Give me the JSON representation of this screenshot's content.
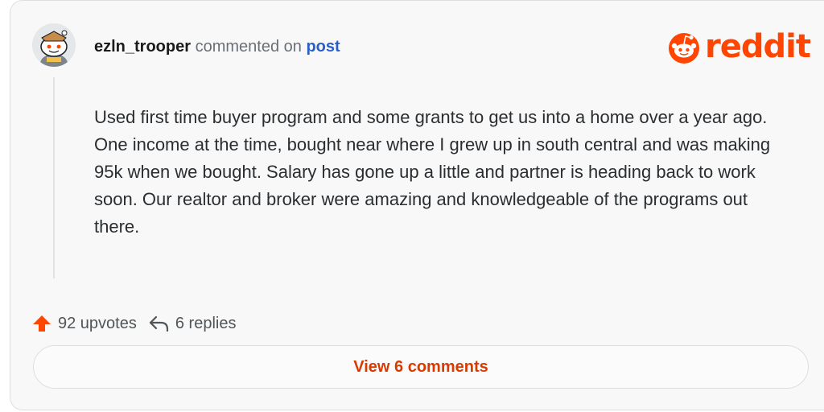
{
  "comment": {
    "author": "ezln_trooper",
    "action_text": "commented on",
    "target_link": "post",
    "body": "Used first time buyer program and some grants to get us into a home over a year ago. One income at the time, bought near where I grew up in south central and was making 95k when we bought. Salary has gone up a little and partner is heading back to work soon. Our realtor and broker were amazing and knowledgeable of the programs out there."
  },
  "brand": {
    "wordmark": "reddit",
    "color": "#ff4500"
  },
  "actions": {
    "upvotes_label": "92 upvotes",
    "replies_label": "6 replies",
    "upvote_icon": "upvote-arrow-icon",
    "reply_icon": "reply-arrow-icon"
  },
  "footer": {
    "view_comments_label": "View 6 comments"
  }
}
